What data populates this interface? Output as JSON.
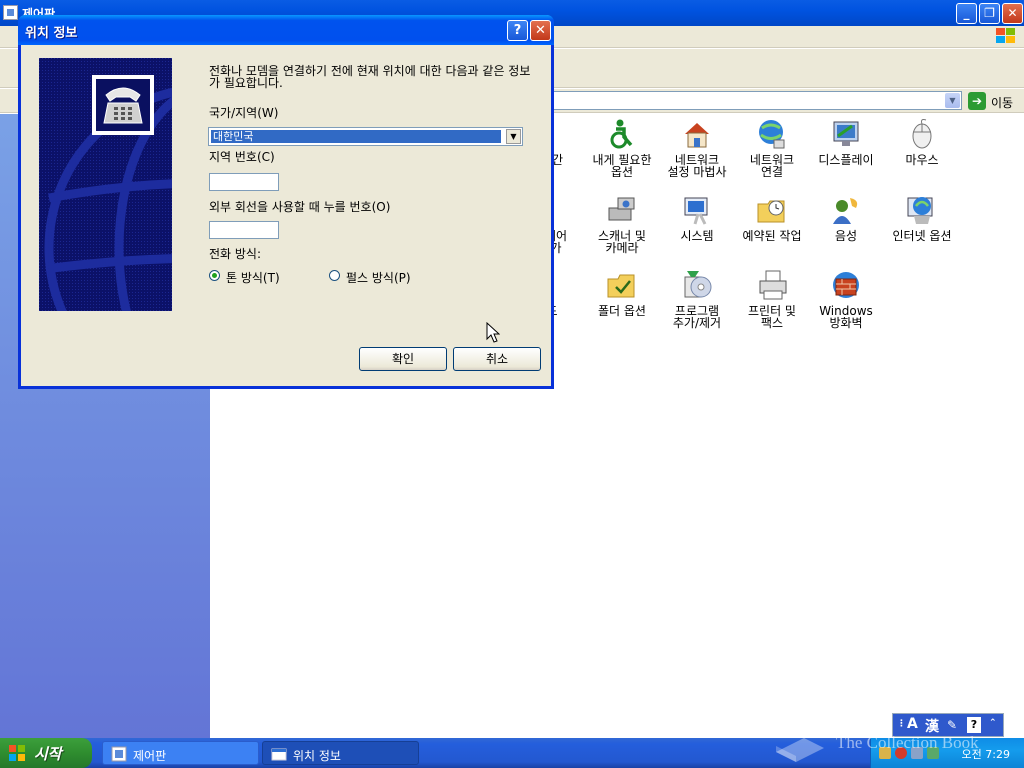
{
  "control_panel": {
    "title": "제어판",
    "address_go": "이동",
    "items": [
      {
        "label": "시간",
        "icon": "clock-icon"
      },
      {
        "label": "내게 필요한\n옵션",
        "icon": "accessibility-icon"
      },
      {
        "label": "네트워크\n설정 마법사",
        "icon": "network-wizard-icon"
      },
      {
        "label": "네트워크\n연결",
        "icon": "network-connections-icon"
      },
      {
        "label": "디스플레이",
        "icon": "display-icon"
      },
      {
        "label": "마우스",
        "icon": "mouse-icon"
      },
      {
        "label": "웨어\n가",
        "icon": "hardware-icon"
      },
      {
        "label": "스캐너 및\n카메라",
        "icon": "scanner-camera-icon"
      },
      {
        "label": "시스템",
        "icon": "system-icon"
      },
      {
        "label": "예약된 작업",
        "icon": "scheduled-tasks-icon"
      },
      {
        "label": "음성",
        "icon": "speech-icon"
      },
      {
        "label": "인터넷 옵션",
        "icon": "internet-options-icon"
      },
      {
        "label": "드",
        "icon": "keyboard-icon"
      },
      {
        "label": "폴더 옵션",
        "icon": "folder-options-icon"
      },
      {
        "label": "프로그램\n추가/제거",
        "icon": "add-remove-programs-icon"
      },
      {
        "label": "프린터 및\n팩스",
        "icon": "printers-faxes-icon"
      },
      {
        "label": "Windows\n방화벽",
        "icon": "firewall-icon"
      }
    ]
  },
  "dialog": {
    "title": "위치 정보",
    "help": "?",
    "close": "✕",
    "description": "전화나 모뎀을 연결하기 전에 현재 위치에 대한 다음과 같은 정보가 필요합니다.",
    "country_label": "국가/지역(W)",
    "country_value": "대한민국",
    "area_code_label": "지역 번호(C)",
    "area_code_value": "",
    "outside_line_label": "외부 회선을 사용할 때 누를 번호(O)",
    "outside_line_value": "",
    "dialing_label": "전화 방식:",
    "dialing_options": [
      {
        "label": "톤 방식(T)",
        "selected": true
      },
      {
        "label": "펄스 방식(P)",
        "selected": false
      }
    ],
    "ok_label": "확인",
    "cancel_label": "취소"
  },
  "taskbar": {
    "start_label": "시작",
    "tasks": [
      {
        "label": "제어판",
        "active": false
      },
      {
        "label": "위치 정보",
        "active": true
      }
    ],
    "clock": "오전 7:29"
  },
  "language_bar": {
    "mode": "A",
    "hanja": "漢"
  },
  "watermark": "The Collection Book",
  "colors": {
    "title_blue": "#0053ee",
    "close_red": "#c2381a",
    "start_green": "#2f8d2f",
    "selection_blue": "#316ac5",
    "panel_left": "#6f8ce0"
  }
}
